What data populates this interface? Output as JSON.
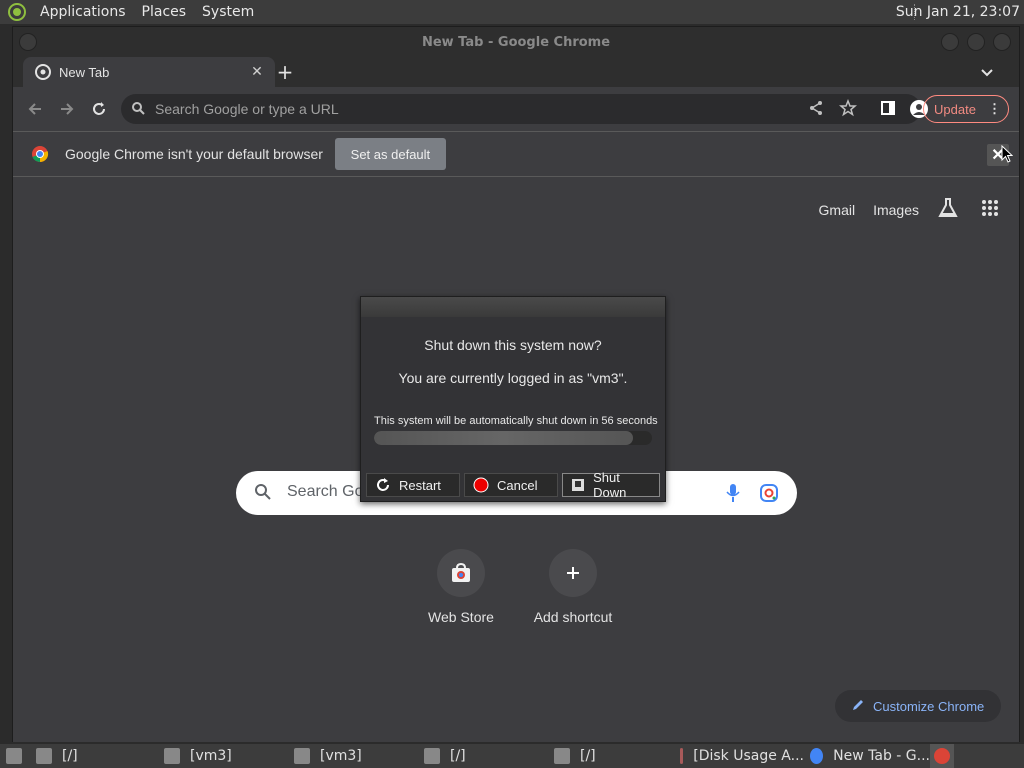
{
  "top_panel": {
    "menus": [
      "Applications",
      "Places",
      "System"
    ],
    "clock": "Sun Jan 21, 23:07"
  },
  "window": {
    "title": "New Tab - Google Chrome"
  },
  "tabs": {
    "active_label": "New Tab"
  },
  "toolbar": {
    "omnibox_placeholder": "Search Google or type a URL",
    "update_label": "Update"
  },
  "infobar": {
    "message": "Google Chrome isn't your default browser",
    "set_default_label": "Set as default"
  },
  "ntp": {
    "links": [
      "Gmail",
      "Images"
    ],
    "search_placeholder": "Search Go",
    "shortcuts": [
      "Web Store",
      "Add shortcut"
    ],
    "customize_label": "Customize Chrome"
  },
  "dialog": {
    "title": "Shut down this system now?",
    "subtitle": "You are currently logged in as \"vm3\".",
    "countdown": "This system will be automatically shut down in 56 seconds",
    "progress": 0.93,
    "buttons": [
      "Restart",
      "Cancel",
      "Shut Down"
    ]
  },
  "taskbar": {
    "items": [
      "[/]",
      "[vm3]",
      "[vm3]",
      "[/]",
      "[/]",
      "[Disk Usage A...",
      "New Tab - G..."
    ]
  }
}
